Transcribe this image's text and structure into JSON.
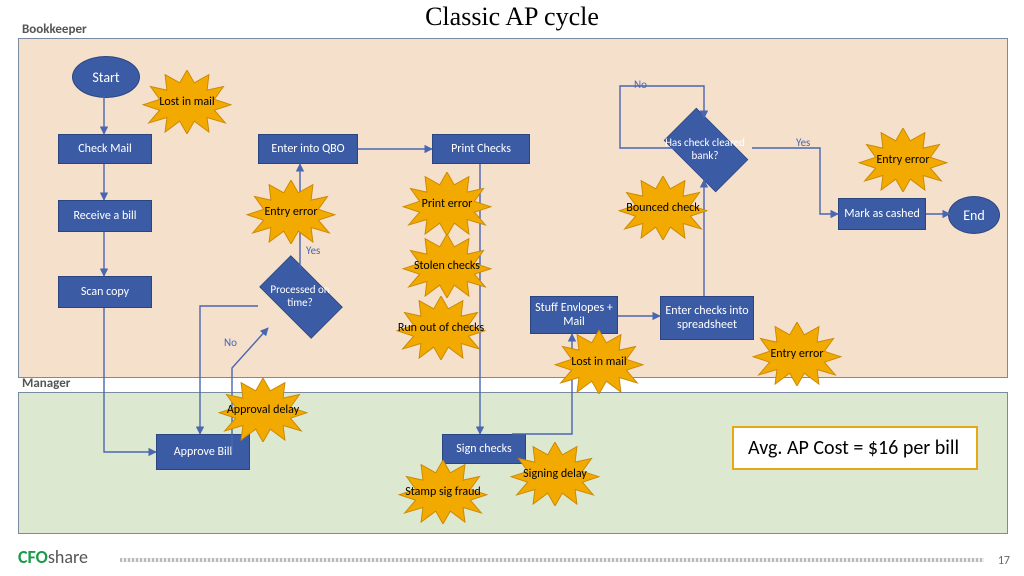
{
  "title": "Classic AP cycle",
  "lanes": {
    "bookkeeper": "Bookkeeper",
    "manager": "Manager"
  },
  "nodes": {
    "start": "Start",
    "check_mail": "Check Mail",
    "receive_bill": "Receive a bill",
    "scan_copy": "Scan copy",
    "approve_bill": "Approve Bill",
    "processed": "Processed on time?",
    "enter_qbo": "Enter into QBO",
    "print_checks": "Print Checks",
    "sign_checks": "Sign checks",
    "stuff_mail": "Stuff Envlopes + Mail",
    "enter_spread": "Enter checks into spreadsheet",
    "cleared": "Has check cleared bank?",
    "mark_cashed": "Mark as cashed",
    "end": "End"
  },
  "edge_labels": {
    "yes": "Yes",
    "no": "No"
  },
  "bursts": {
    "lost_mail_1": "Lost in mail",
    "entry_error_1": "Entry error",
    "print_error": "Print error",
    "stolen_checks": "Stolen checks",
    "run_out": "Run out of checks",
    "lost_mail_2": "Lost in mail",
    "bounced": "Bounced check",
    "entry_error_2": "Entry error",
    "entry_error_3": "Entry error",
    "approval_delay": "Approval delay",
    "signing_delay": "Signing delay",
    "stamp_fraud": "Stamp sig fraud"
  },
  "callout": "Avg. AP Cost = $16 per bill",
  "footer": {
    "logo_cfo": "CFO",
    "logo_share": "share",
    "page": "17"
  }
}
